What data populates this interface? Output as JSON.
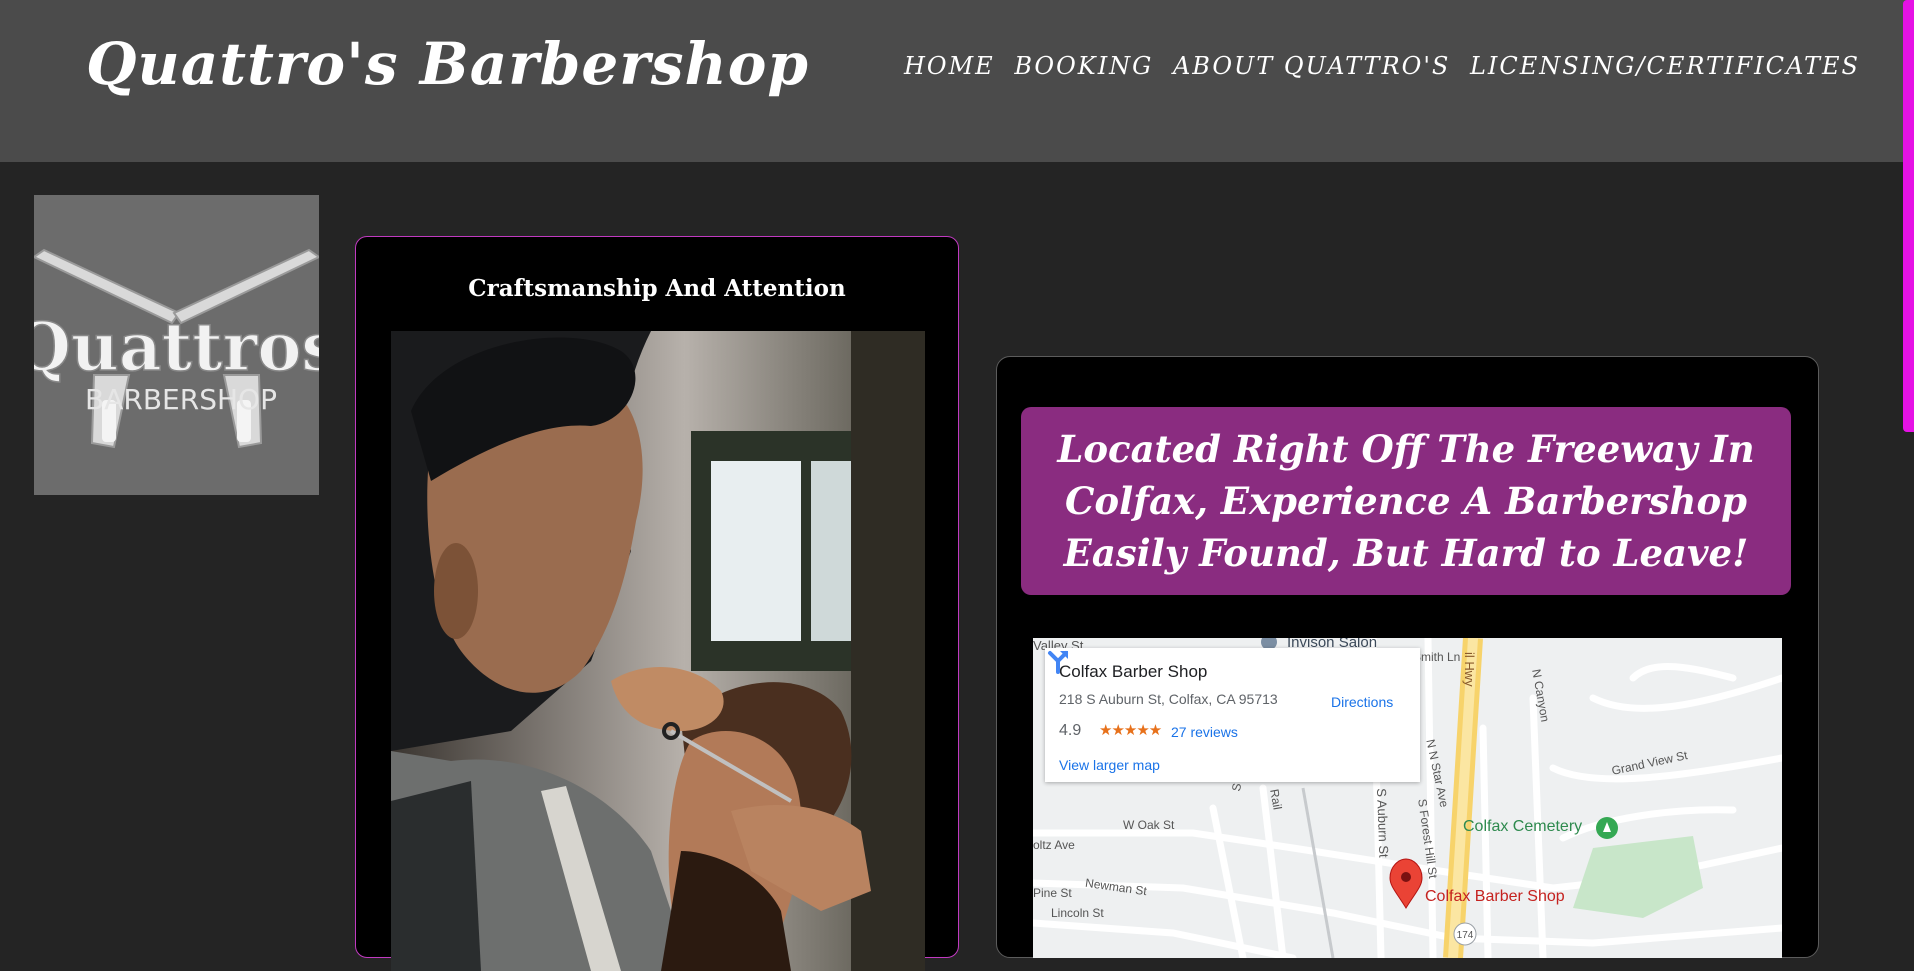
{
  "header": {
    "site_title": "Quattro's Barbershop",
    "nav": [
      {
        "label": "HOME"
      },
      {
        "label": "BOOKING"
      },
      {
        "label": "ABOUT QUATTRO'S"
      },
      {
        "label": "LICENSING/CERTIFICATES"
      }
    ]
  },
  "logo": {
    "line1": "Quattros",
    "line2": "BARBERSHOP"
  },
  "card1": {
    "title": "Craftsmanship And Attention"
  },
  "card2": {
    "banner": "Located Right Off The Freeway In Colfax, Experience A Barbershop Easily Found, But Hard to Leave!"
  },
  "map": {
    "place_name": "Colfax Barber Shop",
    "address": "218 S Auburn St, Colfax, CA 95713",
    "rating": "4.9",
    "stars": "★★★★★",
    "reviews": "27 reviews",
    "directions": "Directions",
    "view_larger": "View larger map",
    "labels": {
      "invison_salon": "Invison Salon",
      "smith_ln": "Smith Ln",
      "n_canyon": "N Canyon",
      "grand_view": "Grand View St",
      "n_star_ave": "N N Star Ave",
      "colfax_cemetery": "Colfax Cemetery",
      "w_oak_st": "W Oak St",
      "oltz_ave": "oltz Ave",
      "newman_st": "Newman St",
      "pine_st": "Pine St",
      "lincoln_st": "Lincoln St",
      "s_auburn_st": "S Auburn St",
      "s_forest_hill": "S Forest Hill St",
      "s_main": "S Main",
      "rail": "Rail",
      "il_hwy": "il Hwy",
      "valley_st": "Valley St",
      "shield_174": "174",
      "marker": "Colfax Barber Shop"
    }
  },
  "colors": {
    "header_bg": "#4b4b4b",
    "page_bg": "#242424",
    "banner_bg": "#8a2c80",
    "card_border": "#c13ac1",
    "scrollbar": "#e512e5"
  }
}
